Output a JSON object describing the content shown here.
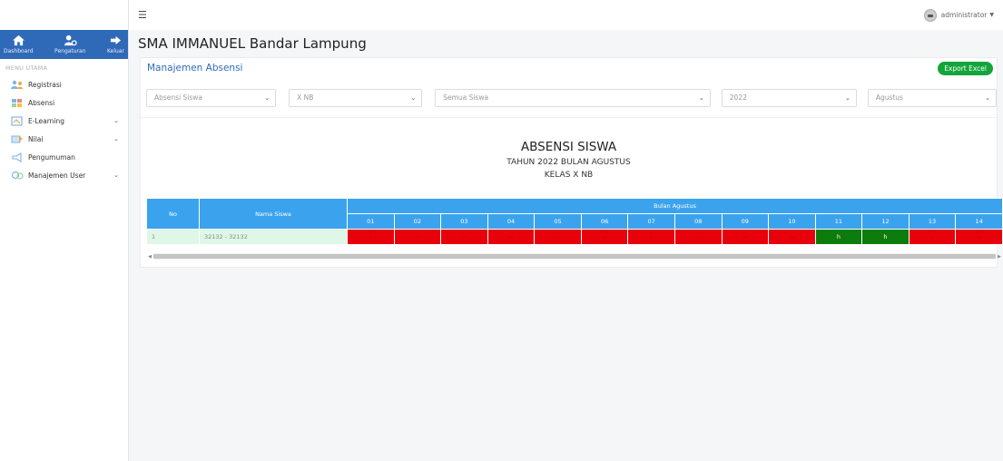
{
  "topbar": {
    "menu_icon": "hamburger-icon",
    "username": "administrator"
  },
  "sidebar": {
    "top_buttons": [
      {
        "label": "Dashboard",
        "icon": "home-icon"
      },
      {
        "label": "Pengaturan",
        "icon": "users-gear-icon"
      },
      {
        "label": "Keluar",
        "icon": "logout-icon"
      }
    ],
    "menu_title": "MENU UTAMA",
    "items": [
      {
        "label": "Registrasi",
        "icon": "registration-icon",
        "has_submenu": false
      },
      {
        "label": "Absensi",
        "icon": "attendance-icon",
        "has_submenu": false
      },
      {
        "label": "E-Learning",
        "icon": "elearning-icon",
        "has_submenu": true
      },
      {
        "label": "Nilai",
        "icon": "grades-icon",
        "has_submenu": true
      },
      {
        "label": "Pengumuman",
        "icon": "announcement-icon",
        "has_submenu": false
      },
      {
        "label": "Manajemen User",
        "icon": "user-management-icon",
        "has_submenu": true
      }
    ]
  },
  "main": {
    "app_title": "SMA IMMANUEL Bandar Lampung",
    "panel_title": "Manajemen Absensi",
    "export_label": "Export Excel",
    "filters": {
      "type": "Absensi Siswa",
      "class": "X NB",
      "student": "Semua Siswa",
      "year": "2022",
      "month": "Agustus"
    },
    "report": {
      "title": "ABSENSI SISWA",
      "subtitle": "TAHUN 2022 BULAN AGUSTUS",
      "class_line": "KELAS X NB"
    },
    "table": {
      "col_no": "No",
      "col_name": "Nama Siswa",
      "month_header": "Bulan Agustus",
      "days": [
        "01",
        "02",
        "03",
        "04",
        "05",
        "06",
        "07",
        "08",
        "09",
        "10",
        "11",
        "12",
        "13",
        "14"
      ],
      "rows": [
        {
          "no": "1",
          "name": "32132 - 32132",
          "marks": [
            "a",
            "a",
            "a",
            "a",
            "a",
            "a",
            "a",
            "a",
            "a",
            "a",
            "h",
            "h",
            "a",
            "a"
          ]
        }
      ]
    }
  },
  "colors": {
    "brand_blue": "#2f6ab8",
    "header_blue": "#3ba3ee",
    "absent_red": "#e8000b",
    "present_green": "#0c7c0c",
    "export_green": "#12a53a"
  }
}
